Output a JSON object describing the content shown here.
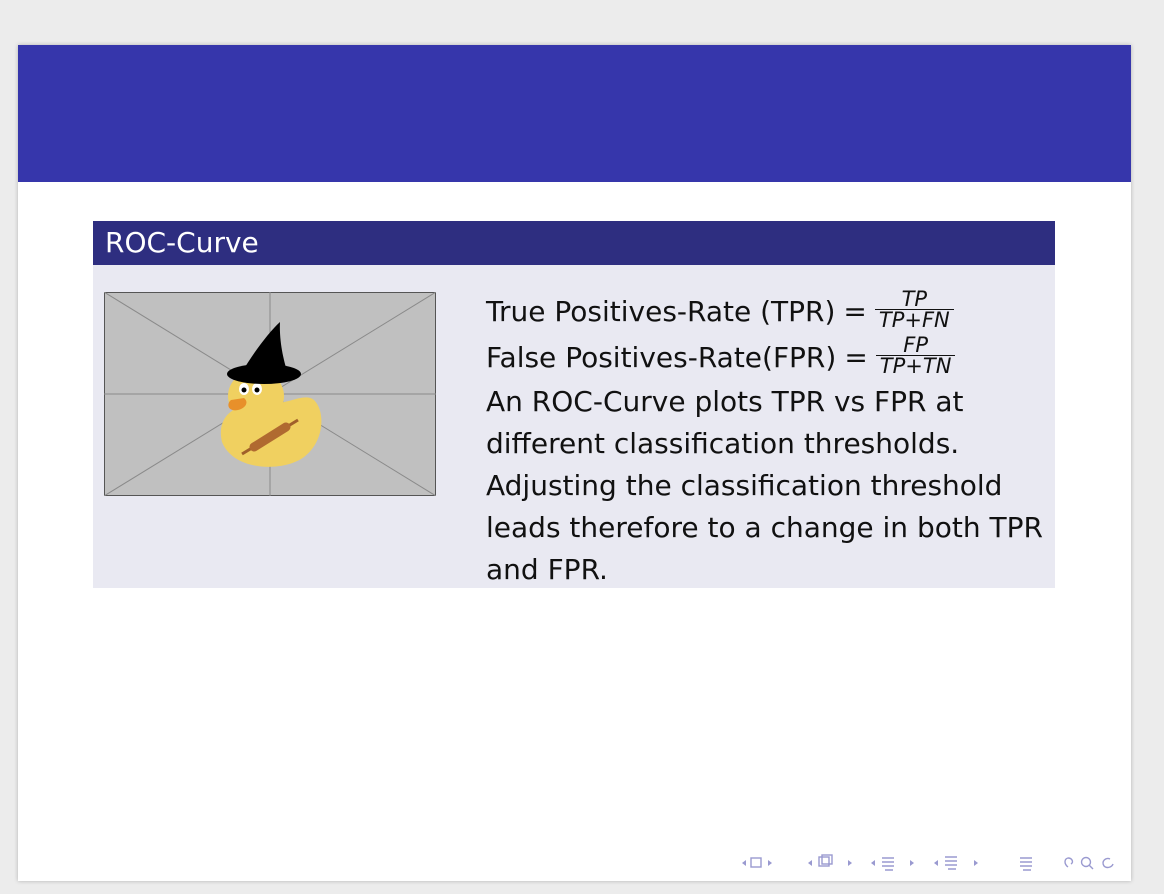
{
  "block": {
    "title": "ROC-Curve"
  },
  "content": {
    "tpr_label": "True Positives-Rate (TPR)",
    "tpr_equals": "=",
    "tpr_num": "TP",
    "tpr_den": "TP+FN",
    "fpr_label": "False Positives-Rate(FPR)",
    "fpr_equals": "=",
    "fpr_num": "FP",
    "fpr_den": "TP+TN",
    "paragraph": "An ROC-Curve plots TPR vs FPR at different classification thresholds. Adjusting the classification threshold leads therefore to a change in both TPR and FPR."
  },
  "colors": {
    "header": "#3636ab",
    "block_title": "#2e2e80",
    "block_body": "#e9e9f2",
    "nav_icons": "#9a9ad0"
  },
  "icons": [
    "duck-witch-hat-image",
    "nav-frame-icon",
    "nav-subsection-icon",
    "nav-section-icon",
    "nav-slide-icon",
    "nav-toc-icon",
    "nav-search-icon"
  ]
}
